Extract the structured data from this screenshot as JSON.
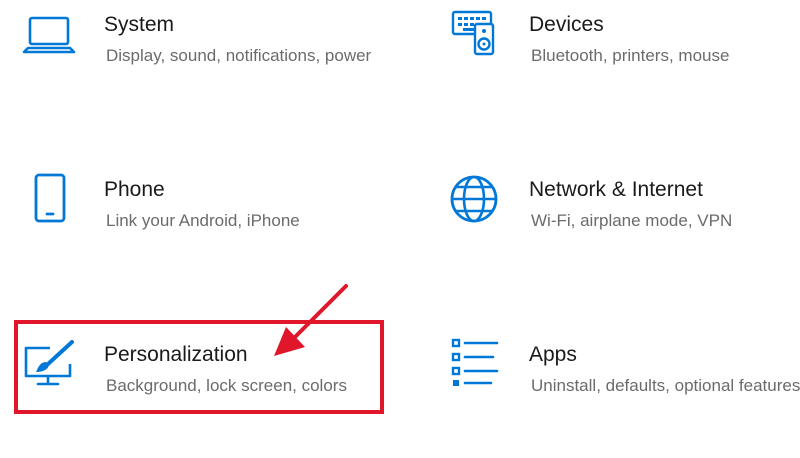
{
  "tiles": {
    "system": {
      "title": "System",
      "desc": "Display, sound, notifications, power",
      "icon": "laptop-icon"
    },
    "devices": {
      "title": "Devices",
      "desc": "Bluetooth, printers, mouse",
      "icon": "devices-icon"
    },
    "phone": {
      "title": "Phone",
      "desc": "Link your Android, iPhone",
      "icon": "phone-icon"
    },
    "network": {
      "title": "Network & Internet",
      "desc": "Wi-Fi, airplane mode, VPN",
      "icon": "globe-icon"
    },
    "personalization": {
      "title": "Personalization",
      "desc": "Background, lock screen, colors",
      "icon": "paint-brush-monitor-icon"
    },
    "apps": {
      "title": "Apps",
      "desc": "Uninstall, defaults, optional features",
      "icon": "apps-list-icon"
    }
  },
  "colors": {
    "accent": "#0078d7",
    "highlight": "#e0162a",
    "title_text": "#1a1a1a",
    "desc_text": "#6b6b6b"
  }
}
